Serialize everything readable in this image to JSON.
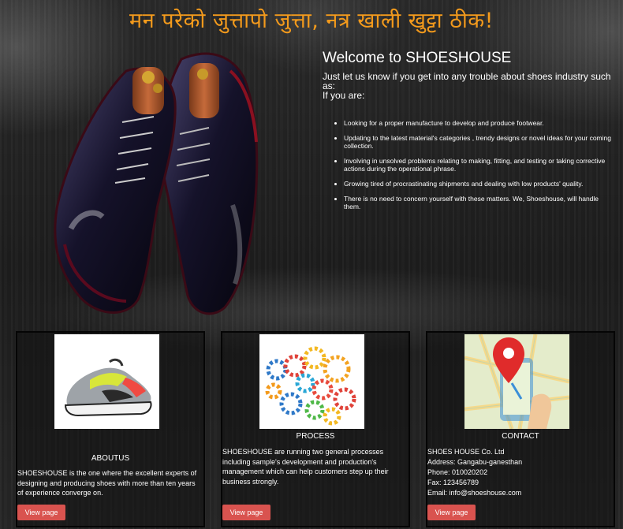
{
  "header": {
    "tagline": "मन परेको जुत्तापो जुत्ता, नत्र खाली खुट्टा ठीक!"
  },
  "welcome": {
    "title": "Welcome to SHOESHOUSE",
    "intro": "Just let us know if you get into any trouble about shoes industry such as:",
    "if_you_are": "If you are:",
    "bullets": [
      "Looking for a proper manufacture to develop and produce footwear.",
      "Updating to the latest material's categories , trendy designs or novel ideas for your coming collection.",
      "Involving in unsolved problems relating to making, fitting, and testing or taking corrective actions during the operational phrase.",
      "Growing tired of procrastinating shipments and dealing with low products' quality.",
      "There is no need to concern yourself with these matters. We, Shoeshouse, will handle them."
    ]
  },
  "cards": [
    {
      "title": "ABOUTUS",
      "text": "SHOESHOUSE is the one where the excellent experts of designing and producing shoes with more than ten years of experience converge on.",
      "button": "View page",
      "image_icon": "sneaker-image"
    },
    {
      "title": "PROCESS",
      "text": "SHOESHOUSE are running two general processes including sample's development and production's management which can help customers step up their business strongly.",
      "button": "View page",
      "image_icon": "gears-image"
    },
    {
      "title": "CONTACT",
      "lines": [
        "SHOES HOUSE Co. Ltd",
        "Address: Gangabu-ganesthan",
        "Phone: 010020202",
        "Fax: 123456789",
        "Email: info@shoeshouse.com"
      ],
      "button": "View page",
      "image_icon": "map-pin-image"
    }
  ],
  "colors": {
    "tagline": "#f39a1c",
    "button": "#d9534f",
    "background": "#1b1b1b"
  }
}
